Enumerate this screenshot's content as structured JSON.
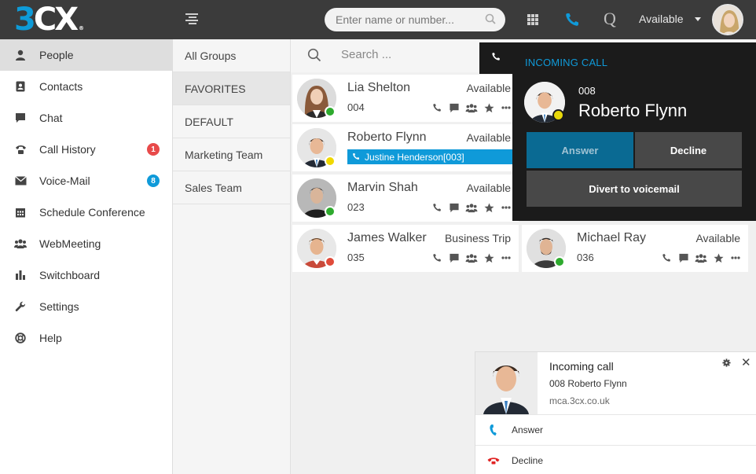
{
  "app": {
    "logo_main": "3CX",
    "logo_mark": "®"
  },
  "header": {
    "search_placeholder": "Enter name or number...",
    "q_label": "Q",
    "status": "Available"
  },
  "sidebar": {
    "items": [
      {
        "label": "People",
        "icon": "person-icon"
      },
      {
        "label": "Contacts",
        "icon": "contacts-icon"
      },
      {
        "label": "Chat",
        "icon": "chat-icon"
      },
      {
        "label": "Call History",
        "icon": "phone-icon",
        "badge": "1",
        "badge_color": "#e84a4a"
      },
      {
        "label": "Voice-Mail",
        "icon": "envelope-icon",
        "badge": "8",
        "badge_color": "#0f9ad9"
      },
      {
        "label": "Schedule Conference",
        "icon": "calendar-icon"
      },
      {
        "label": "WebMeeting",
        "icon": "group-icon"
      },
      {
        "label": "Switchboard",
        "icon": "bar-chart-icon"
      },
      {
        "label": "Settings",
        "icon": "wrench-icon"
      },
      {
        "label": "Help",
        "icon": "lifebuoy-icon"
      }
    ]
  },
  "groups": [
    "All Groups",
    "FAVORITES",
    "DEFAULT",
    "Marketing Team",
    "Sales Team"
  ],
  "people_search": {
    "placeholder": "Search ..."
  },
  "contacts": [
    {
      "name": "Lia Shelton",
      "ext": "004",
      "status": "Available",
      "presence_color": "#2eaa2e"
    },
    {
      "name": "Roberto Flynn",
      "ext": "",
      "status": "Available",
      "presence_color": "#f0d800",
      "in_call_with": "Justine Henderson[003]"
    },
    {
      "name": "Marvin Shah",
      "ext": "023",
      "status": "Available",
      "presence_color": "#2eaa2e"
    },
    {
      "name": "James Walker",
      "ext": "035",
      "status": "Business Trip",
      "presence_color": "#e04b3a"
    },
    {
      "name": "Michael Ray",
      "ext": "036",
      "status": "Available",
      "presence_color": "#2eaa2e"
    }
  ],
  "incoming_call": {
    "title": "INCOMING CALL",
    "ext": "008",
    "name": "Roberto Flynn",
    "answer_label": "Answer",
    "decline_label": "Decline",
    "divert_label": "Divert to voicemail"
  },
  "notification": {
    "title": "Incoming call",
    "body": "008 Roberto Flynn",
    "source": "mca.3cx.co.uk",
    "close": "✕",
    "answer_label": "Answer",
    "decline_label": "Decline"
  },
  "colors": {
    "accent": "#0f9ad9",
    "topbar": "#3b3b3b",
    "panel": "#1b1b1b",
    "decline_red": "#e02424"
  }
}
